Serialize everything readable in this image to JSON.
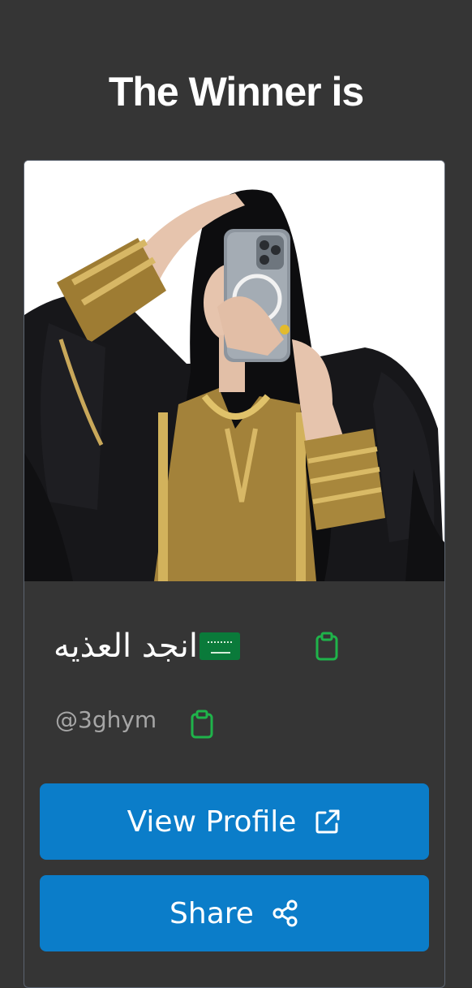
{
  "header": {
    "title": "The Winner is"
  },
  "winner": {
    "display_name": "انجد العذيه",
    "flag_icon": "saudi-flag-icon",
    "handle": "@3ghym",
    "photo_alt": "winner profile photo"
  },
  "actions": {
    "view_profile_label": "View Profile",
    "view_profile_icon": "external-link-icon",
    "share_label": "Share",
    "share_icon": "share-icon"
  },
  "colors": {
    "background": "#353535",
    "card_border": "#5c6470",
    "button": "#0b7dc9",
    "copy_icon": "#1fb34a",
    "handle_text": "#a6a6a6"
  }
}
